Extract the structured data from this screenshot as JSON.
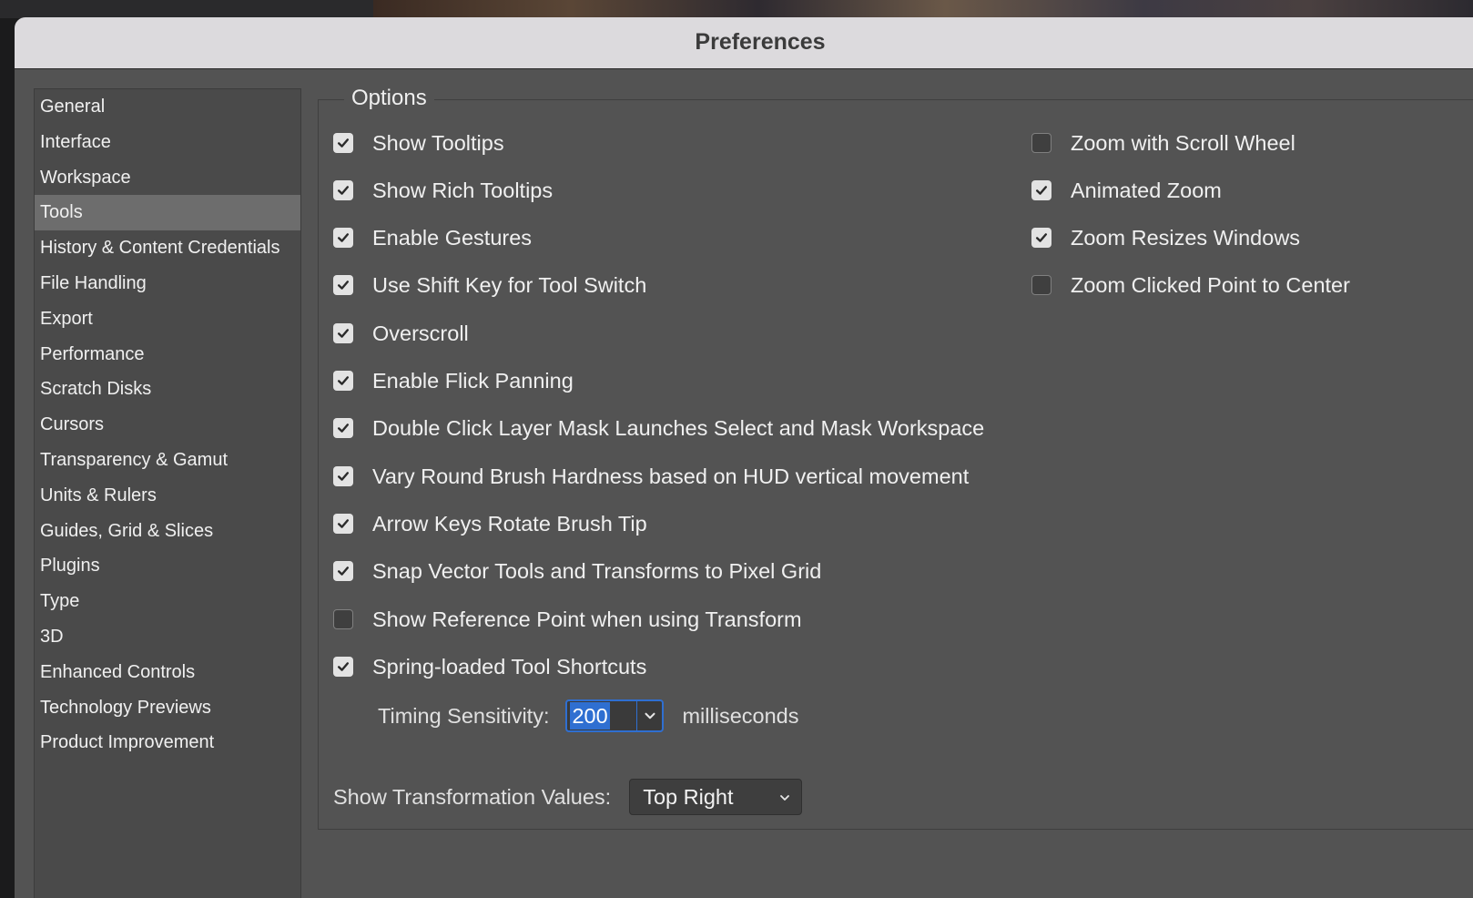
{
  "window": {
    "title": "Preferences"
  },
  "sidebar": {
    "items": [
      {
        "label": "General",
        "selected": false
      },
      {
        "label": "Interface",
        "selected": false
      },
      {
        "label": "Workspace",
        "selected": false
      },
      {
        "label": "Tools",
        "selected": true
      },
      {
        "label": "History & Content Credentials",
        "selected": false
      },
      {
        "label": "File Handling",
        "selected": false
      },
      {
        "label": "Export",
        "selected": false
      },
      {
        "label": "Performance",
        "selected": false
      },
      {
        "label": "Scratch Disks",
        "selected": false
      },
      {
        "label": "Cursors",
        "selected": false
      },
      {
        "label": "Transparency & Gamut",
        "selected": false
      },
      {
        "label": "Units & Rulers",
        "selected": false
      },
      {
        "label": "Guides, Grid & Slices",
        "selected": false
      },
      {
        "label": "Plugins",
        "selected": false
      },
      {
        "label": "Type",
        "selected": false
      },
      {
        "label": "3D",
        "selected": false
      },
      {
        "label": "Enhanced Controls",
        "selected": false
      },
      {
        "label": "Technology Previews",
        "selected": false
      },
      {
        "label": "Product Improvement",
        "selected": false
      }
    ]
  },
  "options": {
    "legend": "Options",
    "left": [
      {
        "label": "Show Tooltips",
        "checked": true
      },
      {
        "label": "Show Rich Tooltips",
        "checked": true
      },
      {
        "label": "Enable Gestures",
        "checked": true
      },
      {
        "label": "Use Shift Key for Tool Switch",
        "checked": true
      },
      {
        "label": "Overscroll",
        "checked": true
      },
      {
        "label": "Enable Flick Panning",
        "checked": true
      },
      {
        "label": "Double Click Layer Mask Launches Select and Mask Workspace",
        "checked": true
      },
      {
        "label": "Vary Round Brush Hardness based on HUD vertical movement",
        "checked": true
      },
      {
        "label": "Arrow Keys Rotate Brush Tip",
        "checked": true
      },
      {
        "label": "Snap Vector Tools and Transforms to Pixel Grid",
        "checked": true
      },
      {
        "label": "Show Reference Point when using Transform",
        "checked": false
      },
      {
        "label": "Spring-loaded Tool Shortcuts",
        "checked": true
      }
    ],
    "right": [
      {
        "label": "Zoom with Scroll Wheel",
        "checked": false
      },
      {
        "label": "Animated Zoom",
        "checked": true
      },
      {
        "label": "Zoom Resizes Windows",
        "checked": true
      },
      {
        "label": "Zoom Clicked Point to Center",
        "checked": false
      }
    ],
    "timing": {
      "label": "Timing Sensitivity:",
      "value": "200",
      "unit": "milliseconds"
    },
    "transform": {
      "label": "Show Transformation Values:",
      "value": "Top Right"
    }
  },
  "colors": {
    "accent": "#2f6fd1",
    "panel": "#535353",
    "titlebar": "#dcdadd"
  }
}
